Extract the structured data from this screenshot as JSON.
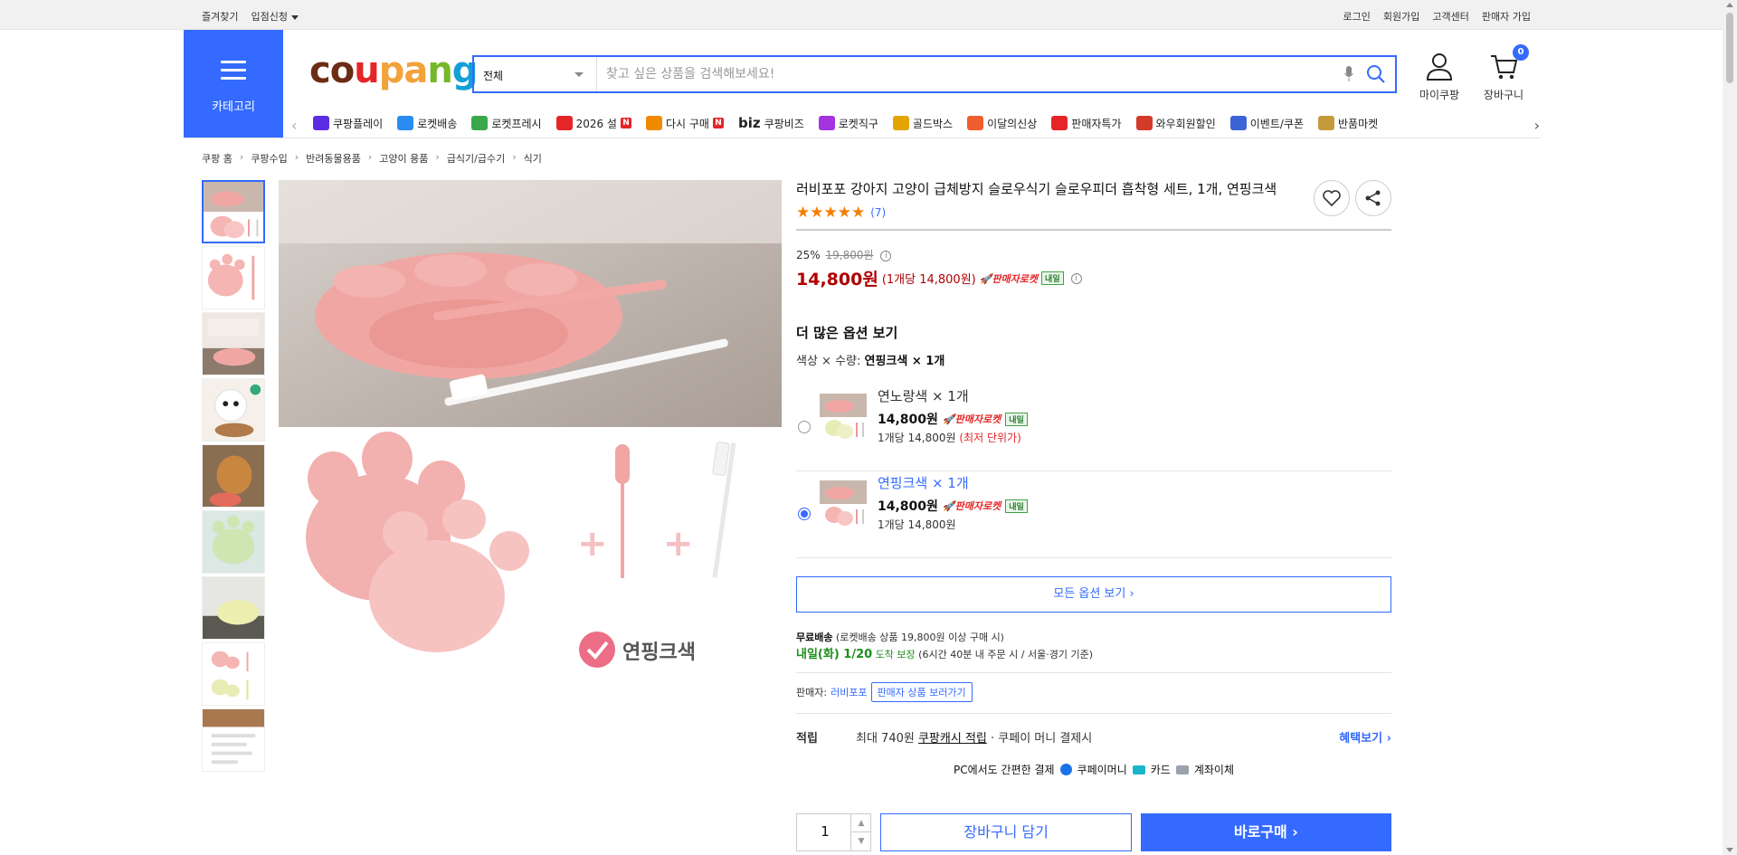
{
  "topbar": {
    "left": [
      "즐겨찾기",
      "입점신청"
    ],
    "right": [
      "로그인",
      "회원가입",
      "고객센터",
      "판매자 가입"
    ]
  },
  "header": {
    "category_label": "카테고리",
    "logo_parts": [
      "co",
      "u",
      "pa",
      "n",
      "g"
    ],
    "search": {
      "scope": "전체",
      "placeholder": "찾고 싶은 상품을 검색해보세요!"
    },
    "mycoupang_label": "마이쿠팡",
    "cart_label": "장바구니",
    "cart_count": "0"
  },
  "nav": [
    {
      "label": "쿠팡플레이",
      "icon": "play-icon",
      "color": "#5b2ee6"
    },
    {
      "label": "로켓배송",
      "icon": "rocket-icon",
      "color": "#2a8bf2"
    },
    {
      "label": "로켓프레시",
      "icon": "rocket-fresh-icon",
      "color": "#3aa84a"
    },
    {
      "label": "2026 설",
      "icon": "gift-icon",
      "color": "#e52528",
      "badge": "N"
    },
    {
      "label": "다시 구매",
      "icon": "home-icon",
      "color": "#f08a00",
      "badge": "N"
    },
    {
      "label": "쿠팡비즈",
      "prefix": "biz",
      "icon": "biz-icon",
      "color": "#222"
    },
    {
      "label": "로켓직구",
      "icon": "global-icon",
      "color": "#a433e0"
    },
    {
      "label": "골드박스",
      "icon": "goldbox-icon",
      "color": "#e3a400"
    },
    {
      "label": "이달의신상",
      "icon": "new-icon",
      "color": "#f05d2f"
    },
    {
      "label": "판매자특가",
      "icon": "sale-icon",
      "color": "#e52528"
    },
    {
      "label": "와우회원할인",
      "icon": "wow-icon",
      "color": "#d43a2a"
    },
    {
      "label": "이벤트/쿠폰",
      "icon": "coupon-icon",
      "color": "#3b64d6"
    },
    {
      "label": "반품마켓",
      "icon": "return-icon",
      "color": "#c49a3a"
    }
  ],
  "breadcrumb": [
    "쿠팡 홈",
    "쿠팡수입",
    "반려동물용품",
    "고양이 용품",
    "급식기/급수기",
    "식기"
  ],
  "product": {
    "title": "러비포포 강아지 고양이 급체방지 슬로우식기 슬로우피더 흡착형 세트, 1개, 연핑크색",
    "stars": "★★★★★",
    "review_count": "(7)",
    "discount": "25%",
    "original_price": "19,800원",
    "price": "14,800원",
    "unit_price": "(1개당 14,800원)",
    "rocket_label": "판매자로켓",
    "arrive_badge": "내일",
    "more_options": "더 많은 옵션 보기",
    "option_summary_prefix": "색상 × 수량: ",
    "option_summary_value": "연핑크색 × 1개",
    "options": [
      {
        "name": "연노랑색 × 1개",
        "price": "14,800원",
        "unit": "1개당 14,800원",
        "note": "(최저 단위가)",
        "selected": false
      },
      {
        "name": "연핑크색 × 1개",
        "price": "14,800원",
        "unit": "1개당 14,800원",
        "note": "",
        "selected": true
      }
    ],
    "all_options": "모든 옵션 보기 ›",
    "shipping_free": "무료배송",
    "shipping_free_note": "(로켓배송 상품 19,800원 이상 구매 시)",
    "shipping_date": "내일(화) 1/20",
    "shipping_guarantee": "도착 보장",
    "shipping_note": "(6시간 40분 내 주문 시 / 서울·경기 기준)",
    "seller_label": "판매자:",
    "seller_name": "러비포포",
    "seller_link": "판매자 상품 보러가기",
    "points_label": "적립",
    "points_prefix": "최대 740원 ",
    "points_link": "쿠팡캐시 적립",
    "points_suffix": " · 쿠페이 머니 결제시",
    "points_more": "혜택보기 ›",
    "pay_intro": "PC에서도 간편한 결제",
    "pay_methods": [
      "쿠페이머니",
      "카드",
      "계좌이체"
    ],
    "quantity": "1",
    "add_cart": "장바구니 담기",
    "buy_now": "바로구매 ›",
    "main_image_caption": "연핑크색"
  }
}
